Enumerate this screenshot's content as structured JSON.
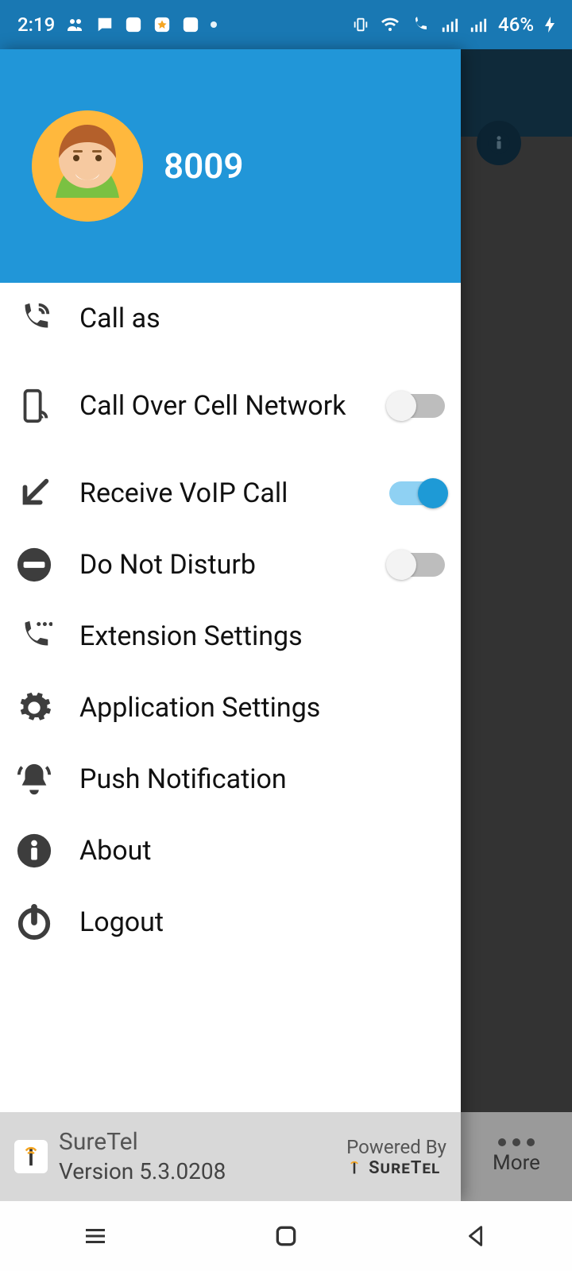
{
  "status": {
    "time": "2:19",
    "battery": "46%"
  },
  "underlay": {
    "more_label": "More"
  },
  "drawer": {
    "username": "8009",
    "items": [
      {
        "label": "Call as",
        "icon": "phone-active-icon",
        "toggle": null
      },
      {
        "label": "Call Over Cell Network",
        "icon": "phone-cell-icon",
        "toggle": false
      },
      {
        "label": "Receive VoIP Call",
        "icon": "incoming-arrow-icon",
        "toggle": true
      },
      {
        "label": "Do Not Disturb",
        "icon": "dnd-icon",
        "toggle": false
      },
      {
        "label": "Extension Settings",
        "icon": "phone-settings-icon",
        "toggle": null
      },
      {
        "label": "Application Settings",
        "icon": "gear-icon",
        "toggle": null
      },
      {
        "label": "Push Notification",
        "icon": "bell-icon",
        "toggle": null
      },
      {
        "label": "About",
        "icon": "info-icon",
        "toggle": null
      },
      {
        "label": "Logout",
        "icon": "power-icon",
        "toggle": null
      }
    ],
    "footer": {
      "app_name": "SureTel",
      "version": "Version 5.3.0208",
      "powered_by": "Powered By",
      "brand": "SureTel"
    }
  }
}
